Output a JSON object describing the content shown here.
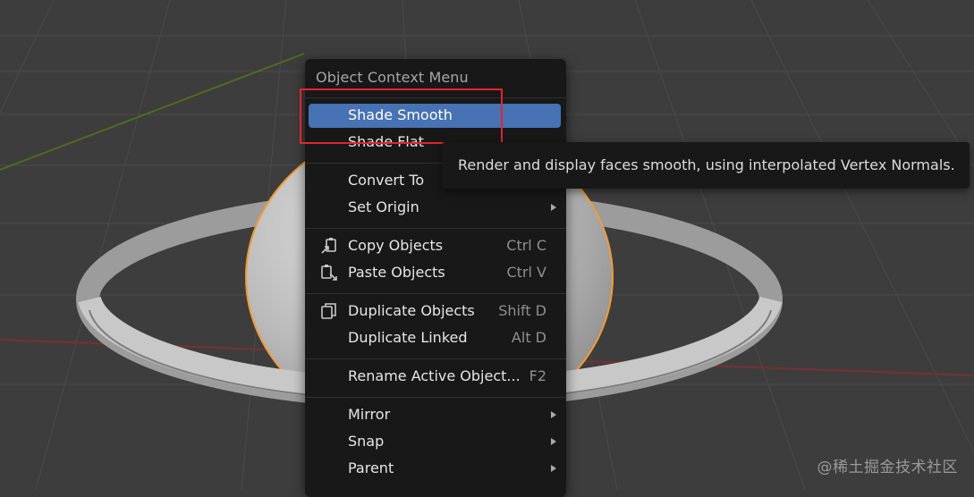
{
  "menu": {
    "title": "Object Context Menu",
    "items": [
      {
        "label": "Shade Smooth"
      },
      {
        "label": "Shade Flat"
      },
      {
        "label": "Convert To"
      },
      {
        "label": "Set Origin"
      },
      {
        "label": "Copy Objects",
        "shortcut": "Ctrl C",
        "icon": "copy-icon"
      },
      {
        "label": "Paste Objects",
        "shortcut": "Ctrl V",
        "icon": "paste-icon"
      },
      {
        "label": "Duplicate Objects",
        "shortcut": "Shift D",
        "icon": "duplicate-icon"
      },
      {
        "label": "Duplicate Linked",
        "shortcut": "Alt D"
      },
      {
        "label": "Rename Active Object...",
        "shortcut": "F2"
      },
      {
        "label": "Mirror"
      },
      {
        "label": "Snap"
      },
      {
        "label": "Parent"
      }
    ]
  },
  "tooltip": {
    "text": "Render and display faces smooth, using interpolated Vertex Normals."
  },
  "watermark": "@稀土掘金技术社区",
  "colors": {
    "viewport_bg": "#3d3d3d",
    "menu_bg": "#181818",
    "active_item": "#4772b3",
    "selection_outline": "#f09b35",
    "annotation_box": "#e0252d",
    "x_axis": "#7a2f34",
    "y_axis": "#4f6a24"
  }
}
